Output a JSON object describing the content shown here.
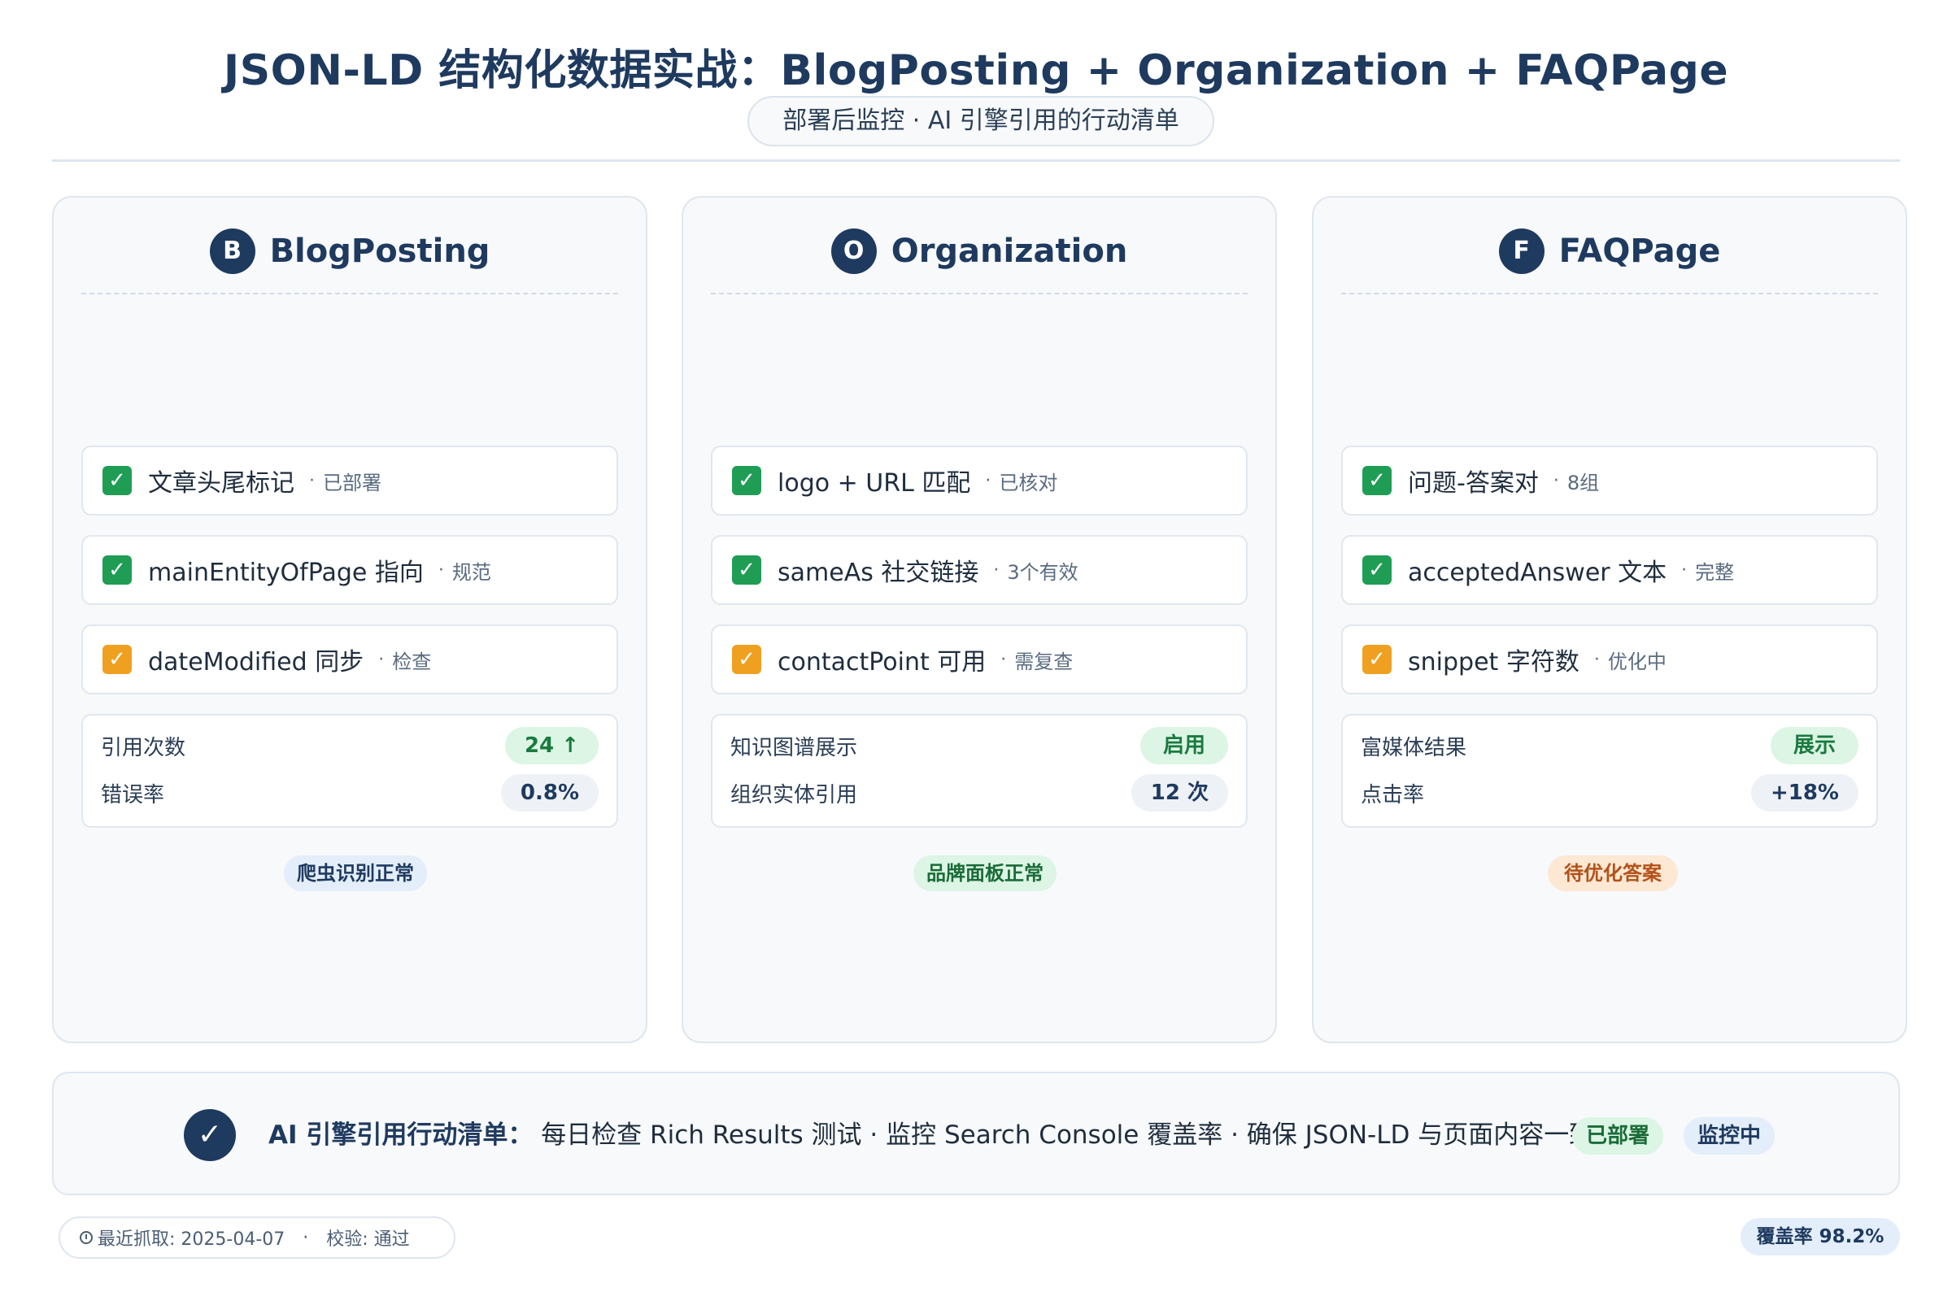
{
  "header": {
    "title": "JSON-LD 结构化数据实战：BlogPosting + Organization + FAQPage",
    "subtitle": "部署后监控 · AI 引擎引用的行动清单"
  },
  "cards": [
    {
      "badge": "B",
      "title": "BlogPosting",
      "items": [
        {
          "status_icon": "check-green",
          "label": "文章头尾标记",
          "status": "已部署"
        },
        {
          "status_icon": "check-green",
          "label": "mainEntityOfPage 指向",
          "status": "规范"
        },
        {
          "status_icon": "check-orange",
          "label": "dateModified 同步",
          "status": "检查"
        }
      ],
      "metrics": [
        {
          "label": "引用次数",
          "value": "24 ↑"
        },
        {
          "label": "错误率",
          "value": "0.8%"
        }
      ],
      "tag": "爬虫识别正常"
    },
    {
      "badge": "O",
      "title": "Organization",
      "items": [
        {
          "status_icon": "check-green",
          "label": "logo + URL 匹配",
          "status": "已核对"
        },
        {
          "status_icon": "check-green",
          "label": "sameAs 社交链接",
          "status": "3个有效"
        },
        {
          "status_icon": "check-orange",
          "label": "contactPoint 可用",
          "status": "需复查"
        }
      ],
      "metrics": [
        {
          "label": "知识图谱展示",
          "value": "启用"
        },
        {
          "label": "组织实体引用",
          "value": "12 次"
        }
      ],
      "tag": "品牌面板正常"
    },
    {
      "badge": "F",
      "title": "FAQPage",
      "items": [
        {
          "status_icon": "check-green",
          "label": "问题-答案对",
          "status": "8组"
        },
        {
          "status_icon": "check-green",
          "label": "acceptedAnswer 文本",
          "status": "完整"
        },
        {
          "status_icon": "check-orange",
          "label": "snippet 字符数",
          "status": "优化中"
        }
      ],
      "metrics": [
        {
          "label": "富媒体结果",
          "value": "展示"
        },
        {
          "label": "点击率",
          "value": "+18%"
        }
      ],
      "tag": "待优化答案"
    }
  ],
  "check_glyph": "✓",
  "separator": "·",
  "banner": {
    "lead": "AI 引擎引用行动清单：",
    "text": "每日检查 Rich Results 测试 · 监控 Search Console 覆盖率 · 确保 JSON-LD 与页面内容一致",
    "pill_deployed": "已部署",
    "pill_monitoring": "监控中"
  },
  "footer": {
    "last_fetch": "最近抓取: 2025-04-07",
    "validation": "校验: 通过",
    "coverage": "覆盖率 98.2%"
  },
  "colors": {
    "primary": "#1f3a5f",
    "check_ok": "#1f9d55",
    "check_warn": "#f0a020",
    "accent_green": "#dcf5e4",
    "accent_orange": "#fde8d4"
  }
}
